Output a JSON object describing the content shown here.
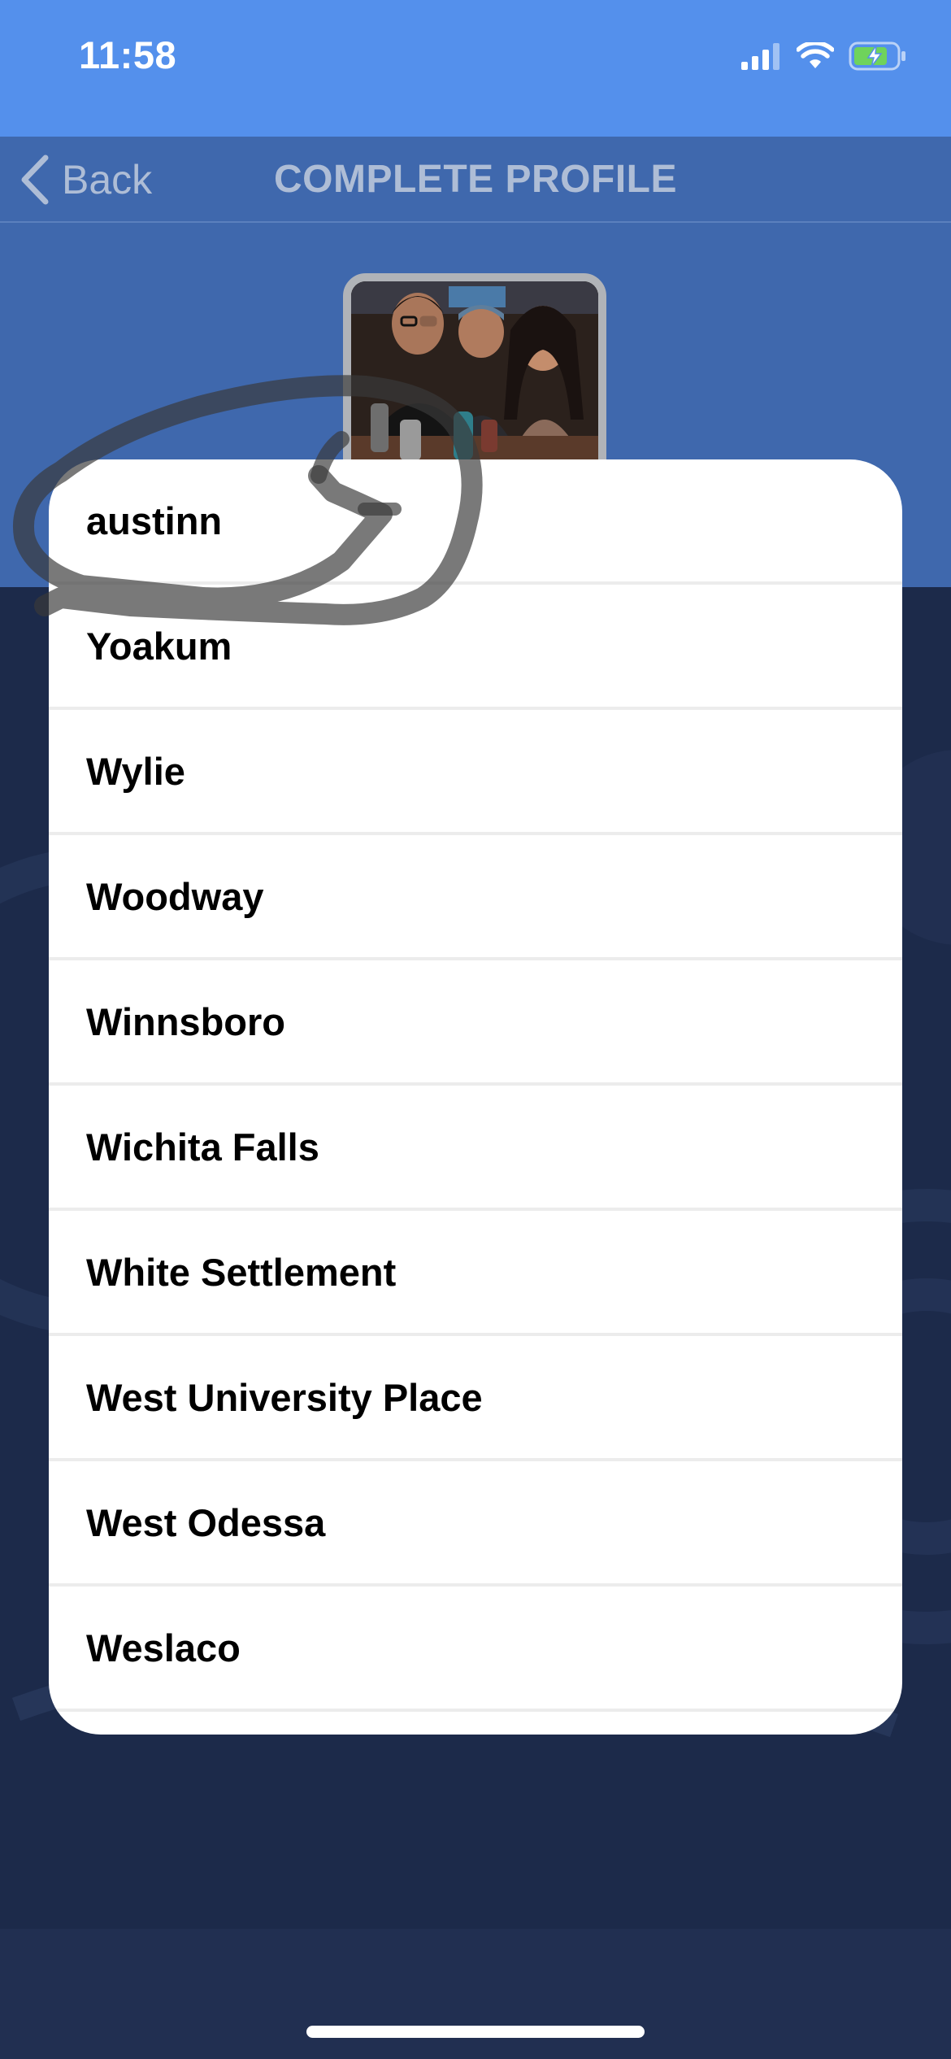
{
  "status_bar": {
    "time": "11:58"
  },
  "nav": {
    "back_label": "Back",
    "title": "COMPLETE PROFILE"
  },
  "city_list": {
    "items": [
      "austinn",
      "Yoakum",
      "Wylie",
      "Woodway",
      "Winnsboro",
      "Wichita Falls",
      "White Settlement",
      "West University Place",
      "West Odessa",
      "Weslaco"
    ]
  },
  "colors": {
    "status_bar_bg": "#5490ec",
    "header_bg": "#3f68ad",
    "dark_bg": "#1c2a4a",
    "list_bg": "#ffffff",
    "battery_fill": "#6fd35b"
  },
  "icons": {
    "status": [
      "cellular-signal-icon",
      "wifi-icon",
      "battery-charging-icon"
    ],
    "nav": [
      "chevron-left-icon"
    ]
  }
}
